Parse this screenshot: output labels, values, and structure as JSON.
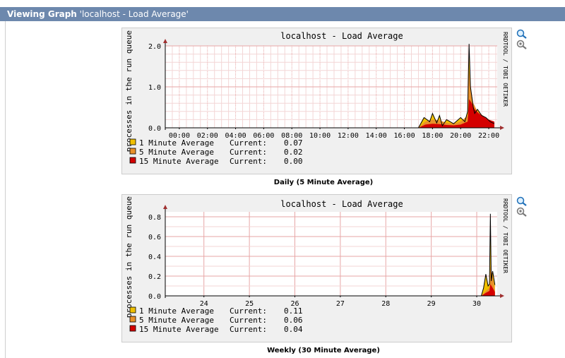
{
  "header": {
    "lead": "Viewing Graph",
    "name": "'localhost - Load Average'"
  },
  "watermark": "RRDTOOL / TOBI OETIKER",
  "graphs": [
    {
      "title": "localhost - Load Average",
      "ylabel": "processes in the run queue",
      "yticks": [
        "2.0",
        "1.0",
        "0.0"
      ],
      "xticks": [
        "00:00",
        "02:00",
        "04:00",
        "06:00",
        "08:00",
        "10:00",
        "12:00",
        "14:00",
        "16:00",
        "18:00",
        "20:00",
        "22:00"
      ],
      "legend": [
        {
          "label": "1 Minute Average",
          "current_label": "Current:",
          "current": "0.07",
          "color": "#f0c000"
        },
        {
          "label": "5 Minute Average",
          "current_label": "Current:",
          "current": "0.02",
          "color": "#e8902a"
        },
        {
          "label": "15 Minute Average",
          "current_label": "Current:",
          "current": "0.00",
          "color": "#d40000"
        }
      ],
      "caption": "Daily (5 Minute Average)"
    },
    {
      "title": "localhost - Load Average",
      "ylabel": "processes in the run queue",
      "yticks": [
        "0.8",
        "0.6",
        "0.4",
        "0.2",
        "0.0"
      ],
      "xticks": [
        "24",
        "25",
        "26",
        "27",
        "28",
        "29",
        "30"
      ],
      "legend": [
        {
          "label": "1 Minute Average",
          "current_label": "Current:",
          "current": "0.11",
          "color": "#f0c000"
        },
        {
          "label": "5 Minute Average",
          "current_label": "Current:",
          "current": "0.06",
          "color": "#e8902a"
        },
        {
          "label": "15 Minute Average",
          "current_label": "Current:",
          "current": "0.04",
          "color": "#d40000"
        }
      ],
      "caption": "Weekly (30 Minute Average)"
    }
  ],
  "chart_data": [
    {
      "type": "area",
      "title": "localhost - Load Average",
      "ylabel": "processes in the run queue",
      "ylim": [
        0,
        2.0
      ],
      "xlim": [
        -1.0,
        22.6
      ],
      "x_unit": "hours",
      "series": [
        {
          "name": "1 Minute Average",
          "x": [
            17.0,
            17.4,
            17.8,
            18.0,
            18.3,
            18.5,
            18.7,
            19.0,
            19.5,
            20.0,
            20.3,
            20.5,
            20.6,
            20.7,
            20.8,
            20.9,
            21.0,
            21.2,
            21.5,
            21.8,
            22.1,
            22.4
          ],
          "y": [
            0.0,
            0.25,
            0.15,
            0.35,
            0.12,
            0.3,
            0.05,
            0.2,
            0.1,
            0.25,
            0.15,
            0.4,
            2.05,
            1.0,
            0.75,
            0.5,
            0.35,
            0.45,
            0.3,
            0.25,
            0.15,
            0.1
          ]
        },
        {
          "name": "5 Minute Average",
          "x": [
            17.0,
            17.5,
            18.0,
            18.5,
            19.0,
            19.5,
            20.0,
            20.5,
            20.6,
            20.7,
            20.9,
            21.2,
            21.5,
            21.8,
            22.1,
            22.4
          ],
          "y": [
            0.0,
            0.15,
            0.2,
            0.18,
            0.12,
            0.1,
            0.15,
            0.3,
            1.4,
            1.0,
            0.6,
            0.4,
            0.32,
            0.25,
            0.18,
            0.12
          ]
        },
        {
          "name": "15 Minute Average",
          "x": [
            17.0,
            17.5,
            18.0,
            18.5,
            19.0,
            19.5,
            20.0,
            20.5,
            20.6,
            20.8,
            21.0,
            21.3,
            21.6,
            22.0,
            22.4
          ],
          "y": [
            0.0,
            0.08,
            0.1,
            0.09,
            0.07,
            0.06,
            0.08,
            0.15,
            0.7,
            0.6,
            0.45,
            0.35,
            0.28,
            0.2,
            0.15
          ]
        }
      ],
      "grid": true
    },
    {
      "type": "area",
      "title": "localhost - Load Average",
      "ylabel": "processes in the run queue",
      "ylim": [
        0,
        0.85
      ],
      "xlim": [
        23.15,
        30.45
      ],
      "x_unit": "day",
      "series": [
        {
          "name": "1 Minute Average",
          "x": [
            30.1,
            30.15,
            30.2,
            30.25,
            30.28,
            30.3,
            30.32,
            30.35,
            30.4
          ],
          "y": [
            0.0,
            0.08,
            0.22,
            0.1,
            0.12,
            0.83,
            0.15,
            0.25,
            0.11
          ]
        },
        {
          "name": "5 Minute Average",
          "x": [
            30.1,
            30.2,
            30.28,
            30.3,
            30.35,
            30.4
          ],
          "y": [
            0.0,
            0.05,
            0.08,
            0.3,
            0.2,
            0.06
          ]
        },
        {
          "name": "15 Minute Average",
          "x": [
            30.1,
            30.2,
            30.28,
            30.3,
            30.35,
            30.4
          ],
          "y": [
            0.0,
            0.03,
            0.05,
            0.12,
            0.08,
            0.04
          ]
        }
      ],
      "grid": true
    }
  ]
}
